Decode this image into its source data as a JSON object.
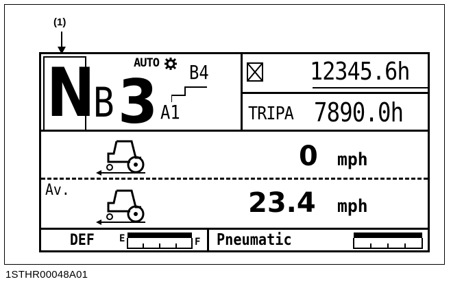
{
  "figure": {
    "callout_label": "(1)",
    "figure_code": "1STHR00048A01"
  },
  "display": {
    "shift": {
      "range_letter": "N",
      "gear_prefix": "B",
      "gear_number": "3",
      "auto_label": "AUTO",
      "upper_gear": "B4",
      "lower_gear": "A1"
    },
    "hours": {
      "engine_hours": "12345.6h",
      "trip_label": "TRIPA",
      "trip_hours": "7890.0h"
    },
    "speed_rows": [
      {
        "prefix": "",
        "value": "0",
        "unit": "mph"
      },
      {
        "prefix": "Av.",
        "value": "23.4",
        "unit": "mph"
      }
    ],
    "gauges": {
      "def_label": "DEF",
      "def_empty": "E",
      "def_full": "F",
      "pneumatic_label": "Pneumatic"
    },
    "icons": [
      "gear-icon",
      "hourglass-icon",
      "tractor-icon",
      "arrow-down-icon"
    ]
  }
}
